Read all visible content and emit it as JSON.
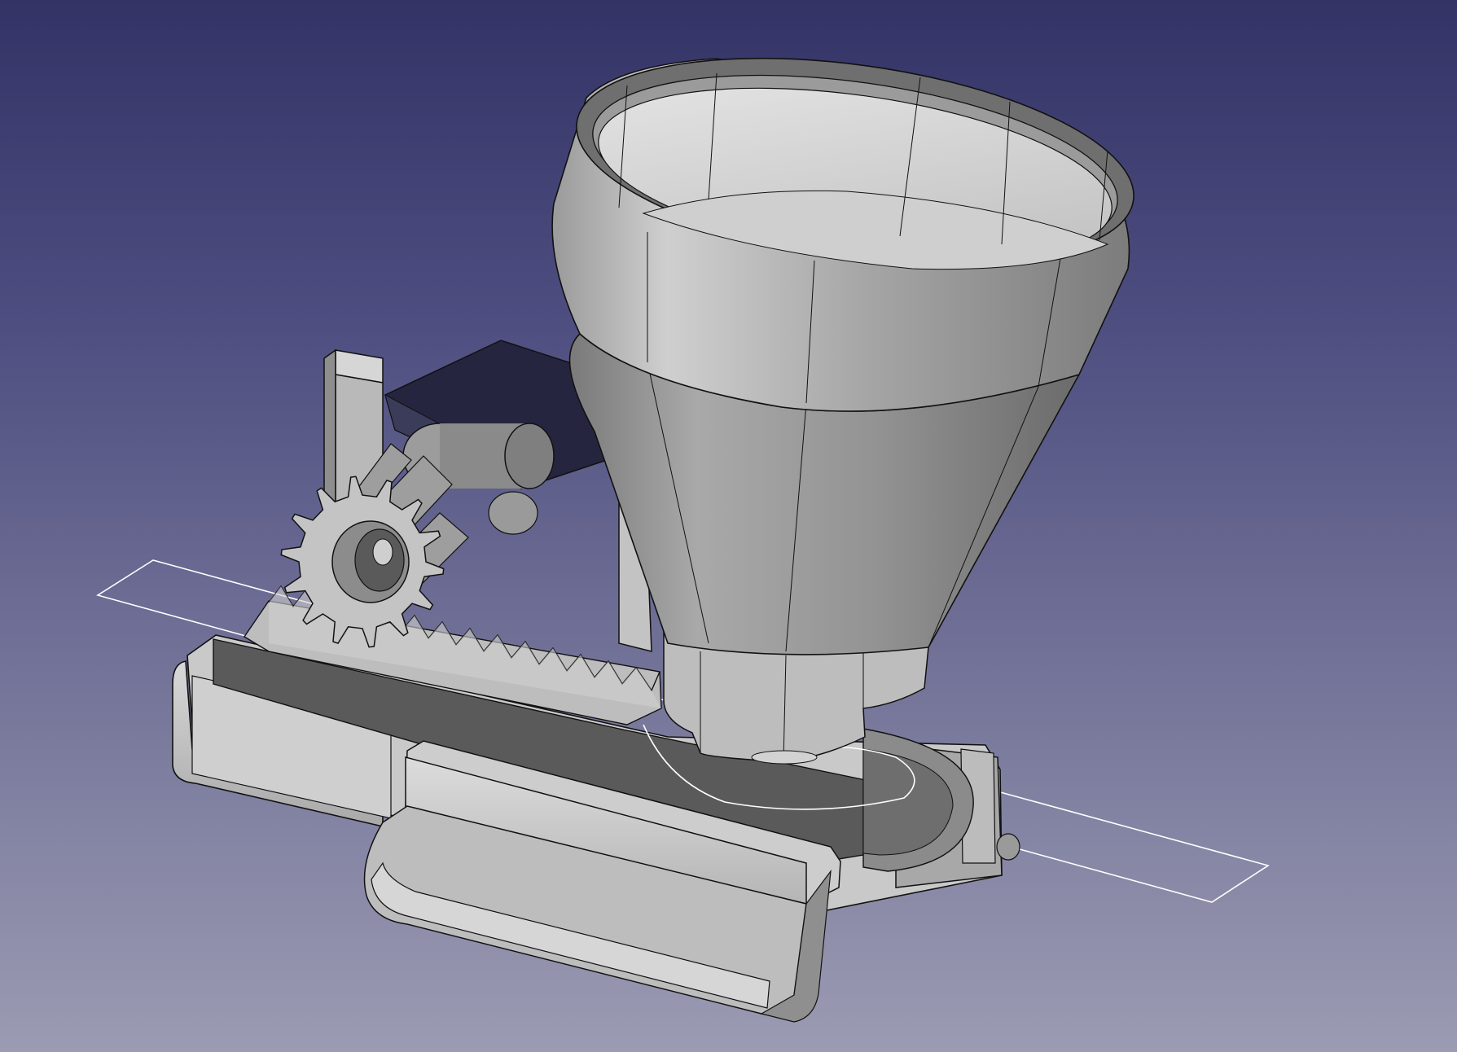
{
  "viewport": {
    "name": "3d-view",
    "background_top": "#333366",
    "background_bottom": "#9b9bb3"
  },
  "model": {
    "part_color": "#c8c8c8",
    "edge_color": "#111111",
    "selection_color": "#ffffff",
    "components": [
      "hopper-funnel",
      "pinion-gear",
      "gear-rack",
      "base-housing",
      "motor-bracket",
      "slide-tray",
      "sketch-rectangle"
    ]
  }
}
